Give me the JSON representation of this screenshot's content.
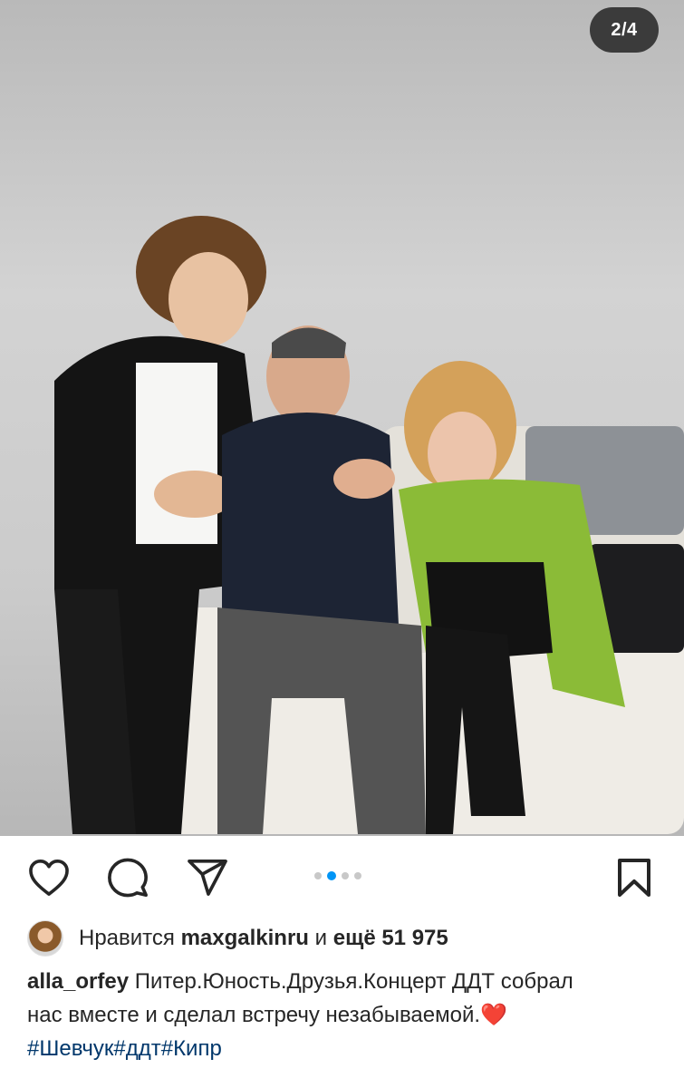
{
  "post": {
    "carousel_counter": "2/4",
    "carousel": {
      "total": 4,
      "active_index": 2
    },
    "likes": {
      "prefix": "Нравится",
      "user": "maxgalkinru",
      "middle": "и",
      "suffix": "ещё 51 975"
    },
    "caption": {
      "username": "alla_orfey",
      "line1": "Питер.Юность.Друзья.Концерт ДДТ собрал",
      "line2": "нас вместе и сделал встречу незабываемой.",
      "emoji": "❤️",
      "hashtags": "#Шевчук#ддт#Кипр"
    }
  },
  "icons": {
    "like": "heart-outline-icon",
    "comment": "comment-bubble-icon",
    "share": "paper-plane-icon",
    "save": "bookmark-icon"
  },
  "colors": {
    "text": "#262626",
    "hashtag": "#00376b",
    "active_dot": "#0095f6",
    "heart": "#ed4956"
  }
}
